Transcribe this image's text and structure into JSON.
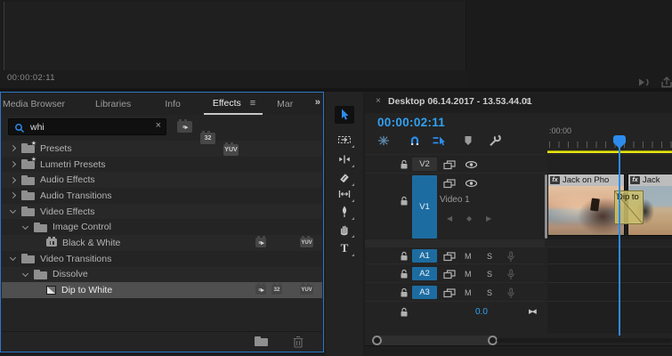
{
  "monitor": {
    "timecode": "00:00:02:11"
  },
  "effects": {
    "tabs": [
      {
        "label": "Media Browser"
      },
      {
        "label": "Libraries"
      },
      {
        "label": "Info"
      },
      {
        "label": "Effects"
      },
      {
        "label": "Mar"
      }
    ],
    "panel_menu": "≡",
    "overflow": "»",
    "search": {
      "value": "whi",
      "clear": "×"
    },
    "badges": {
      "bit32": "32",
      "yuv": "YUV"
    },
    "tree": [
      {
        "label": "Presets"
      },
      {
        "label": "Lumetri Presets"
      },
      {
        "label": "Audio Effects"
      },
      {
        "label": "Audio Transitions"
      },
      {
        "label": "Video Effects"
      },
      {
        "label": "Image Control"
      },
      {
        "label": "Black & White",
        "badges": {
          "yuv": "YUV"
        }
      },
      {
        "label": "Video Transitions"
      },
      {
        "label": "Dissolve"
      },
      {
        "label": "Dip to White",
        "badges": {
          "bit32": "32",
          "yuv": "YUV"
        }
      }
    ]
  },
  "tools": {
    "type_label": "T"
  },
  "timeline": {
    "tab": {
      "close": "×",
      "title": "Desktop 06.14.2017 - 13.53.44.01",
      "menu": "≡"
    },
    "timecode": "00:00:02:11",
    "ruler": {
      "label": ":00:00"
    },
    "video_tracks": [
      {
        "label": "V2"
      },
      {
        "label": "V1",
        "name": "Video 1"
      }
    ],
    "audio_tracks": [
      {
        "label": "A1",
        "mute": "M",
        "solo": "S"
      },
      {
        "label": "A2",
        "mute": "M",
        "solo": "S"
      },
      {
        "label": "A3",
        "mute": "M",
        "solo": "S"
      }
    ],
    "master": {
      "gain": "0.0"
    },
    "keyframe_nav": {
      "prev": "◀",
      "add": "◆",
      "next": "▶"
    },
    "bowtie": "▶◀",
    "clips": [
      {
        "fx": "fx",
        "name": "Jack on Pho"
      },
      {
        "fx": "fx",
        "name": "Jack"
      }
    ],
    "transition": {
      "label": "Dip to"
    }
  }
}
